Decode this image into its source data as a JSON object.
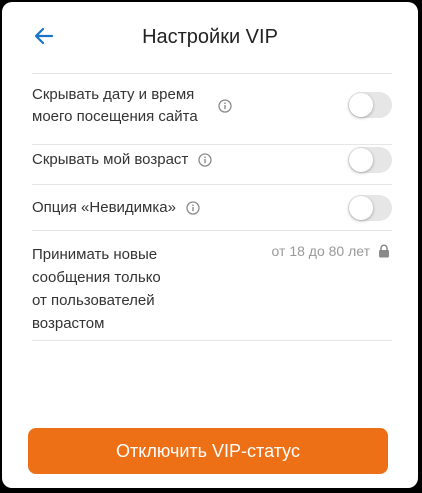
{
  "header": {
    "title": "Настройки VIP",
    "back_icon": "arrow-left-icon"
  },
  "settings": {
    "hide_visit_time": {
      "label_line1": "Скрывать дату и время",
      "label_line2": "моего посещения сайта",
      "enabled": false
    },
    "hide_age": {
      "label": "Скрывать мой возраст",
      "enabled": false
    },
    "invisible": {
      "label": "Опция «Невидимка»",
      "enabled": false
    },
    "accept_messages": {
      "label_line1": "Принимать новые",
      "label_line2": "сообщения только",
      "label_line3": "от пользователей",
      "label_line4": "возрастом",
      "value": "от 18 до 80 лет",
      "locked": true
    }
  },
  "footer": {
    "disable_vip_label": "Отключить VIP-статус"
  },
  "colors": {
    "accent": "#1a73c8",
    "cta": "#ee7016",
    "toggle_off": "#e6e6e6"
  }
}
